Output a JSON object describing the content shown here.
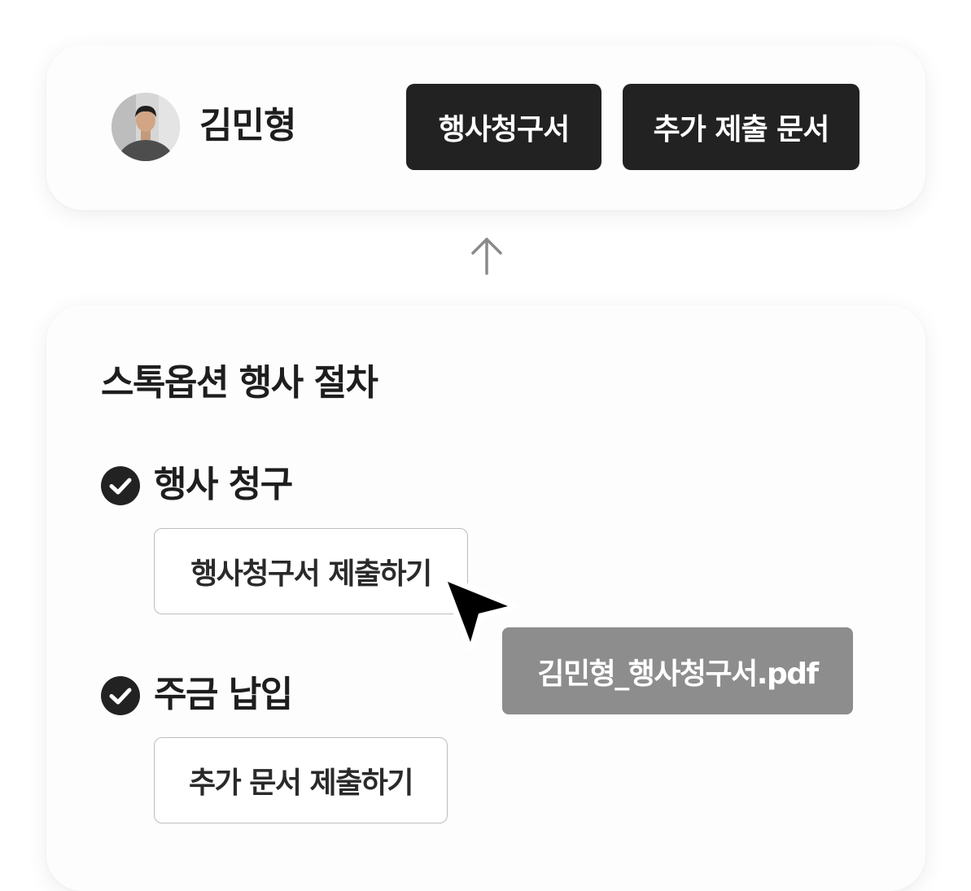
{
  "user": {
    "name": "김민형",
    "avatar_icon": "user-photo"
  },
  "actions": {
    "claim_button": "행사청구서",
    "additional_button": "추가 제출 문서"
  },
  "connector_icon": "arrow-up-icon",
  "procedure": {
    "title": "스톡옵션 행사 절차",
    "steps": [
      {
        "label": "행사 청구",
        "status_icon": "check-circle-icon",
        "action_label": "행사청구서 제출하기"
      },
      {
        "label": "주금 납입",
        "status_icon": "check-circle-icon",
        "action_label": "추가 문서 제출하기"
      }
    ]
  },
  "dragged_file": {
    "name": "김민형_행사청구서.pdf"
  },
  "colors": {
    "dark_button": "#222222",
    "file_chip": "#8d8d8d",
    "check": "#222222",
    "arrow": "#8a8a8a"
  }
}
